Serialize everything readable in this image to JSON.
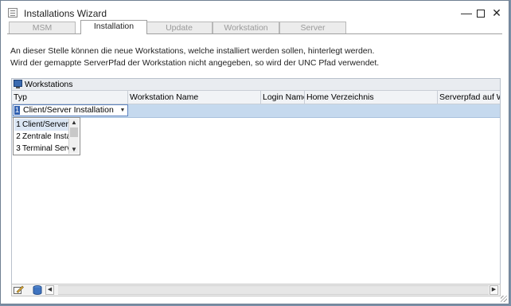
{
  "window": {
    "title": "Installations Wizard"
  },
  "controls": {
    "minimize": "—",
    "close": "✕"
  },
  "tabs": [
    {
      "label": "MSM",
      "active": false
    },
    {
      "label": "Installation",
      "active": true
    },
    {
      "label": "Update",
      "active": false
    },
    {
      "label": "Workstation",
      "active": false
    },
    {
      "label": "Server",
      "active": false
    }
  ],
  "info": {
    "line1": "An dieser Stelle können die neue Workstations, welche installiert werden sollen, hinterlegt werden.",
    "line2": "Wird der gemappte ServerPfad der Workstation nicht angegeben, so wird der UNC Pfad verwendet."
  },
  "grid": {
    "caption": "Workstations",
    "columns": [
      "Typ",
      "Workstation Name",
      "Login Name",
      "Home Verzeichnis",
      "Serverpfad auf Wor"
    ],
    "current_row": {
      "typ_index": "1",
      "typ_value": "Client/Server Installation"
    }
  },
  "dropdown": {
    "options": [
      {
        "num": "1",
        "label": "Client/Server I"
      },
      {
        "num": "2",
        "label": "Zentrale Instal"
      },
      {
        "num": "3",
        "label": "Terminal Serve"
      }
    ]
  },
  "colors": {
    "selected_row": "#c5d9ee",
    "accent": "#2f5fb0"
  }
}
